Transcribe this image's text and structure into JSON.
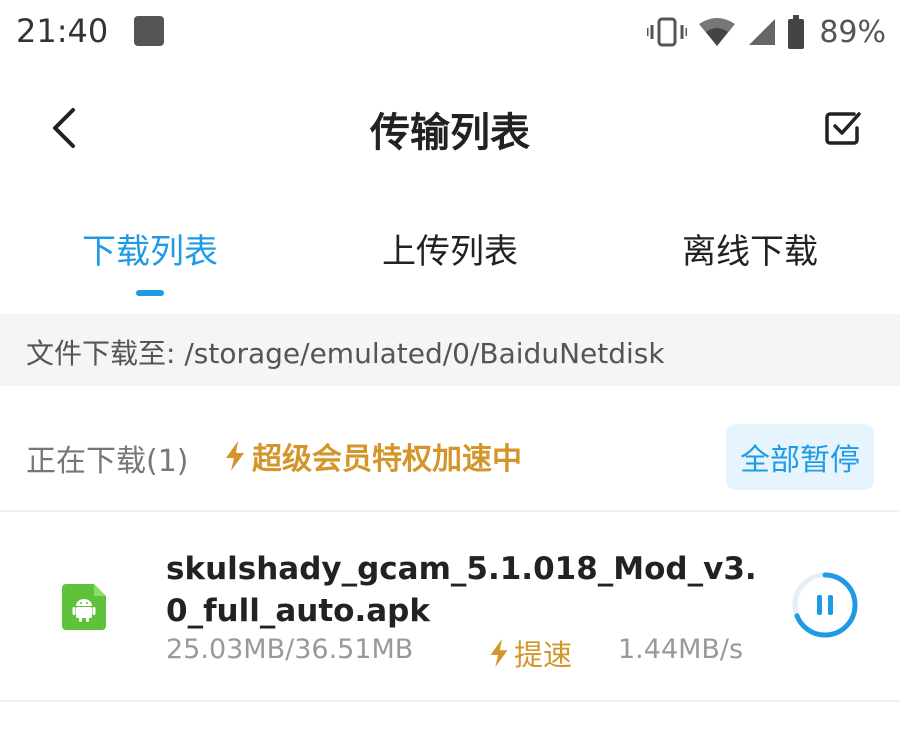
{
  "status_bar": {
    "time": "21:40",
    "battery": "89%",
    "icons": [
      "notification-square-icon",
      "vibrate-icon",
      "wifi-icon",
      "signal-icon",
      "battery-icon"
    ]
  },
  "header": {
    "title": "传输列表",
    "back_icon": "back-arrow-icon",
    "select_icon": "checkbox-icon"
  },
  "tabs": [
    {
      "label": "下载列表",
      "active": true
    },
    {
      "label": "上传列表",
      "active": false
    },
    {
      "label": "离线下载",
      "active": false
    }
  ],
  "path": {
    "text": "文件下载至: /storage/emulated/0/BaiduNetdisk"
  },
  "section": {
    "count_label": "正在下载(1)",
    "vip_label": "超级会员特权加速中",
    "pause_all": "全部暂停"
  },
  "items": [
    {
      "name": "skulshady_gcam_5.1.018_Mod_v3.0_full_auto.apk",
      "size": "25.03MB/36.51MB",
      "boost": "提速",
      "speed": "1.44MB/s",
      "progress": 0.69,
      "icon": "android-apk-icon"
    }
  ],
  "colors": {
    "accent": "#1f9be6",
    "vip": "#d4952a",
    "apk": "#5ec23a"
  }
}
